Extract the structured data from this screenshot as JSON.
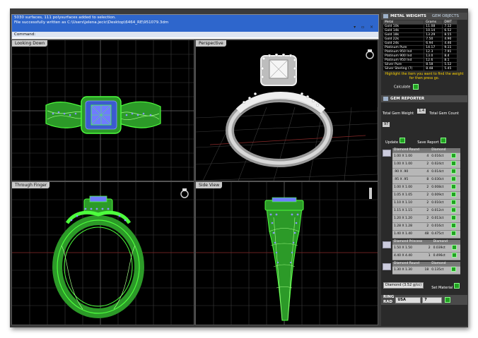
{
  "command_area": {
    "history_line1": "5030 surfaces, 111 polysurfaces added to selection.",
    "history_line2": "File successfully written as C:\\Users\\jelena.jecic\\Desktop\\6464_RE\\951079.3dm",
    "command_label": "Command:",
    "controls": "▾ ▫ ×"
  },
  "viewports": {
    "top": {
      "title": "Looking Down"
    },
    "perspective": {
      "title": "Perspective"
    },
    "front": {
      "title": "Through Finger"
    },
    "right": {
      "title": "Side View"
    }
  },
  "metal_weights": {
    "header": "METAL WEIGHTS",
    "tab": "GEM OBJECTS",
    "columns": [
      "Metal",
      "Grams",
      "DWT"
    ],
    "rows": [
      [
        "Gold 10k",
        "11.08",
        "7.12"
      ],
      [
        "Gold 14k",
        "10.14",
        "6.52"
      ],
      [
        "Gold 18k",
        "13.29",
        "8.55"
      ],
      [
        "Gold 22k",
        "7.50",
        "4.90"
      ],
      [
        "Gold 24k",
        "6.94",
        "4.46"
      ],
      [
        "Platinum Pure",
        "14.17",
        "9.11"
      ],
      [
        "Platinum 950 Ind",
        "12.3",
        "7.91"
      ],
      [
        "Platinum 900 Ind",
        "13.0",
        "8.4"
      ],
      [
        "Platinum 950 Ind",
        "12.6",
        "8.1"
      ],
      [
        "Silver Pure",
        "8.58",
        "5.52"
      ],
      [
        "Silver Sterling (7)",
        "8.48",
        "5.45"
      ]
    ],
    "hint": "Highlight the item you want to find the weight for then press go.",
    "calculate_label": "Calculate"
  },
  "gem_reporter": {
    "header": "GEM REPORTER",
    "total_weight_label": "Total Gem Weight",
    "total_weight_value": "1.4",
    "total_count_label": "Total Gem Count",
    "total_count_value": "97",
    "update_label": "Update",
    "save_report_label": "Save Report",
    "groups": [
      {
        "shape": "Diamond Round",
        "type": "Diamond",
        "rows": [
          [
            "1.00 X 1.00",
            "4",
            "0.016ct"
          ],
          [
            "1.00 X 1.00",
            "2",
            "0.024ct"
          ],
          [
            ".90 X .90",
            "4",
            "0.014ct"
          ],
          [
            ".95 X .95",
            "8",
            "0.030ct"
          ],
          [
            "1.00 X 1.00",
            "2",
            "0.008ct"
          ],
          [
            "1.05 X 1.05",
            "2",
            "0.009ct"
          ],
          [
            "1.10 X 1.10",
            "2",
            "0.010ct"
          ],
          [
            "1.15 X 1.15",
            "2",
            "0.012ct"
          ],
          [
            "1.20 X 1.20",
            "2",
            "0.013ct"
          ],
          [
            "1.28 X 1.28",
            "2",
            "0.016ct"
          ],
          [
            "1.40 X 1.40",
            "48",
            "0.475ct"
          ]
        ]
      },
      {
        "shape": "Diamond Princess",
        "type": "Diamond",
        "rows": [
          [
            "1.50 X 1.50",
            "2",
            "0.039ct"
          ],
          [
            "4.40 X 4.40",
            "1",
            "0.496ct"
          ]
        ]
      },
      {
        "shape": "Diamond Round",
        "type": "Diamond",
        "rows": [
          [
            "1.30 X 1.30",
            "18",
            "0.135ct"
          ]
        ]
      }
    ],
    "material_value": "Diamond (3.52 g/cc)",
    "set_material_label": "Set Material"
  },
  "ring": {
    "label": "RING",
    "label2": "RAD",
    "size_system": "USA",
    "size_value": "7"
  },
  "colors": {
    "wire": "#4dff3d",
    "gem": "#6f7cff",
    "grid": "#3a3a3a",
    "accent": "#2e66cc"
  }
}
